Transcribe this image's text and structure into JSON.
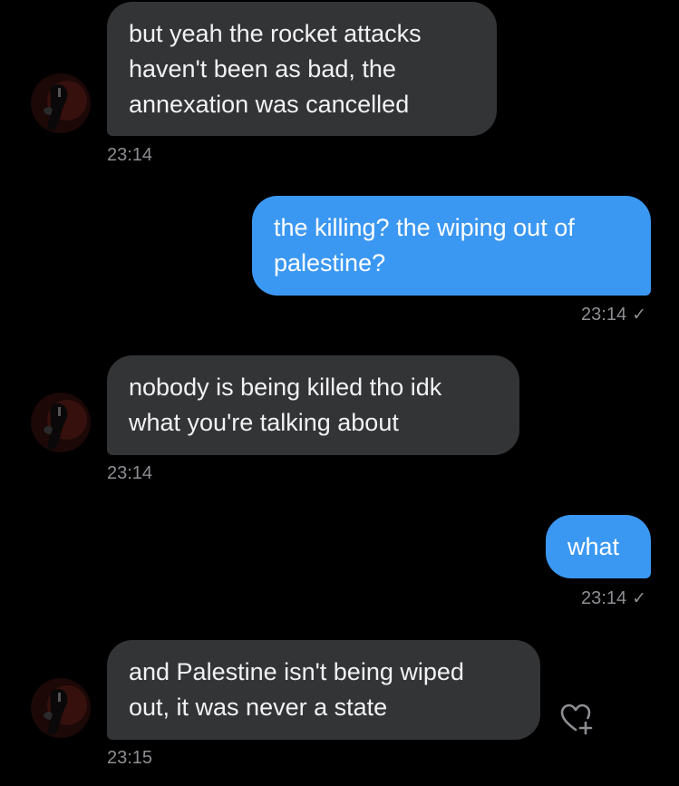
{
  "messages": [
    {
      "direction": "incoming",
      "lines": [
        "but yeah the rocket attacks",
        "haven't been as bad, the",
        "annexation was cancelled"
      ],
      "time": "23:14"
    },
    {
      "direction": "outgoing",
      "lines": [
        "the killing? the wiping out of",
        "palestine?"
      ],
      "time": "23:14",
      "status_icon": "check-icon"
    },
    {
      "direction": "incoming",
      "lines": [
        "nobody is being killed tho idk",
        "what you're talking about"
      ],
      "time": "23:14"
    },
    {
      "direction": "outgoing",
      "lines": [
        "what"
      ],
      "time": "23:14",
      "status_icon": "check-icon"
    },
    {
      "direction": "incoming",
      "lines": [
        "and Palestine isn't being wiped",
        "out, it was never a state"
      ],
      "time": "23:15",
      "reaction_icon": "heart-add-icon"
    }
  ],
  "colors": {
    "background": "#000000",
    "incoming_bubble": "#333436",
    "outgoing_bubble": "#3b98f2",
    "timestamp": "#8d8e92"
  }
}
